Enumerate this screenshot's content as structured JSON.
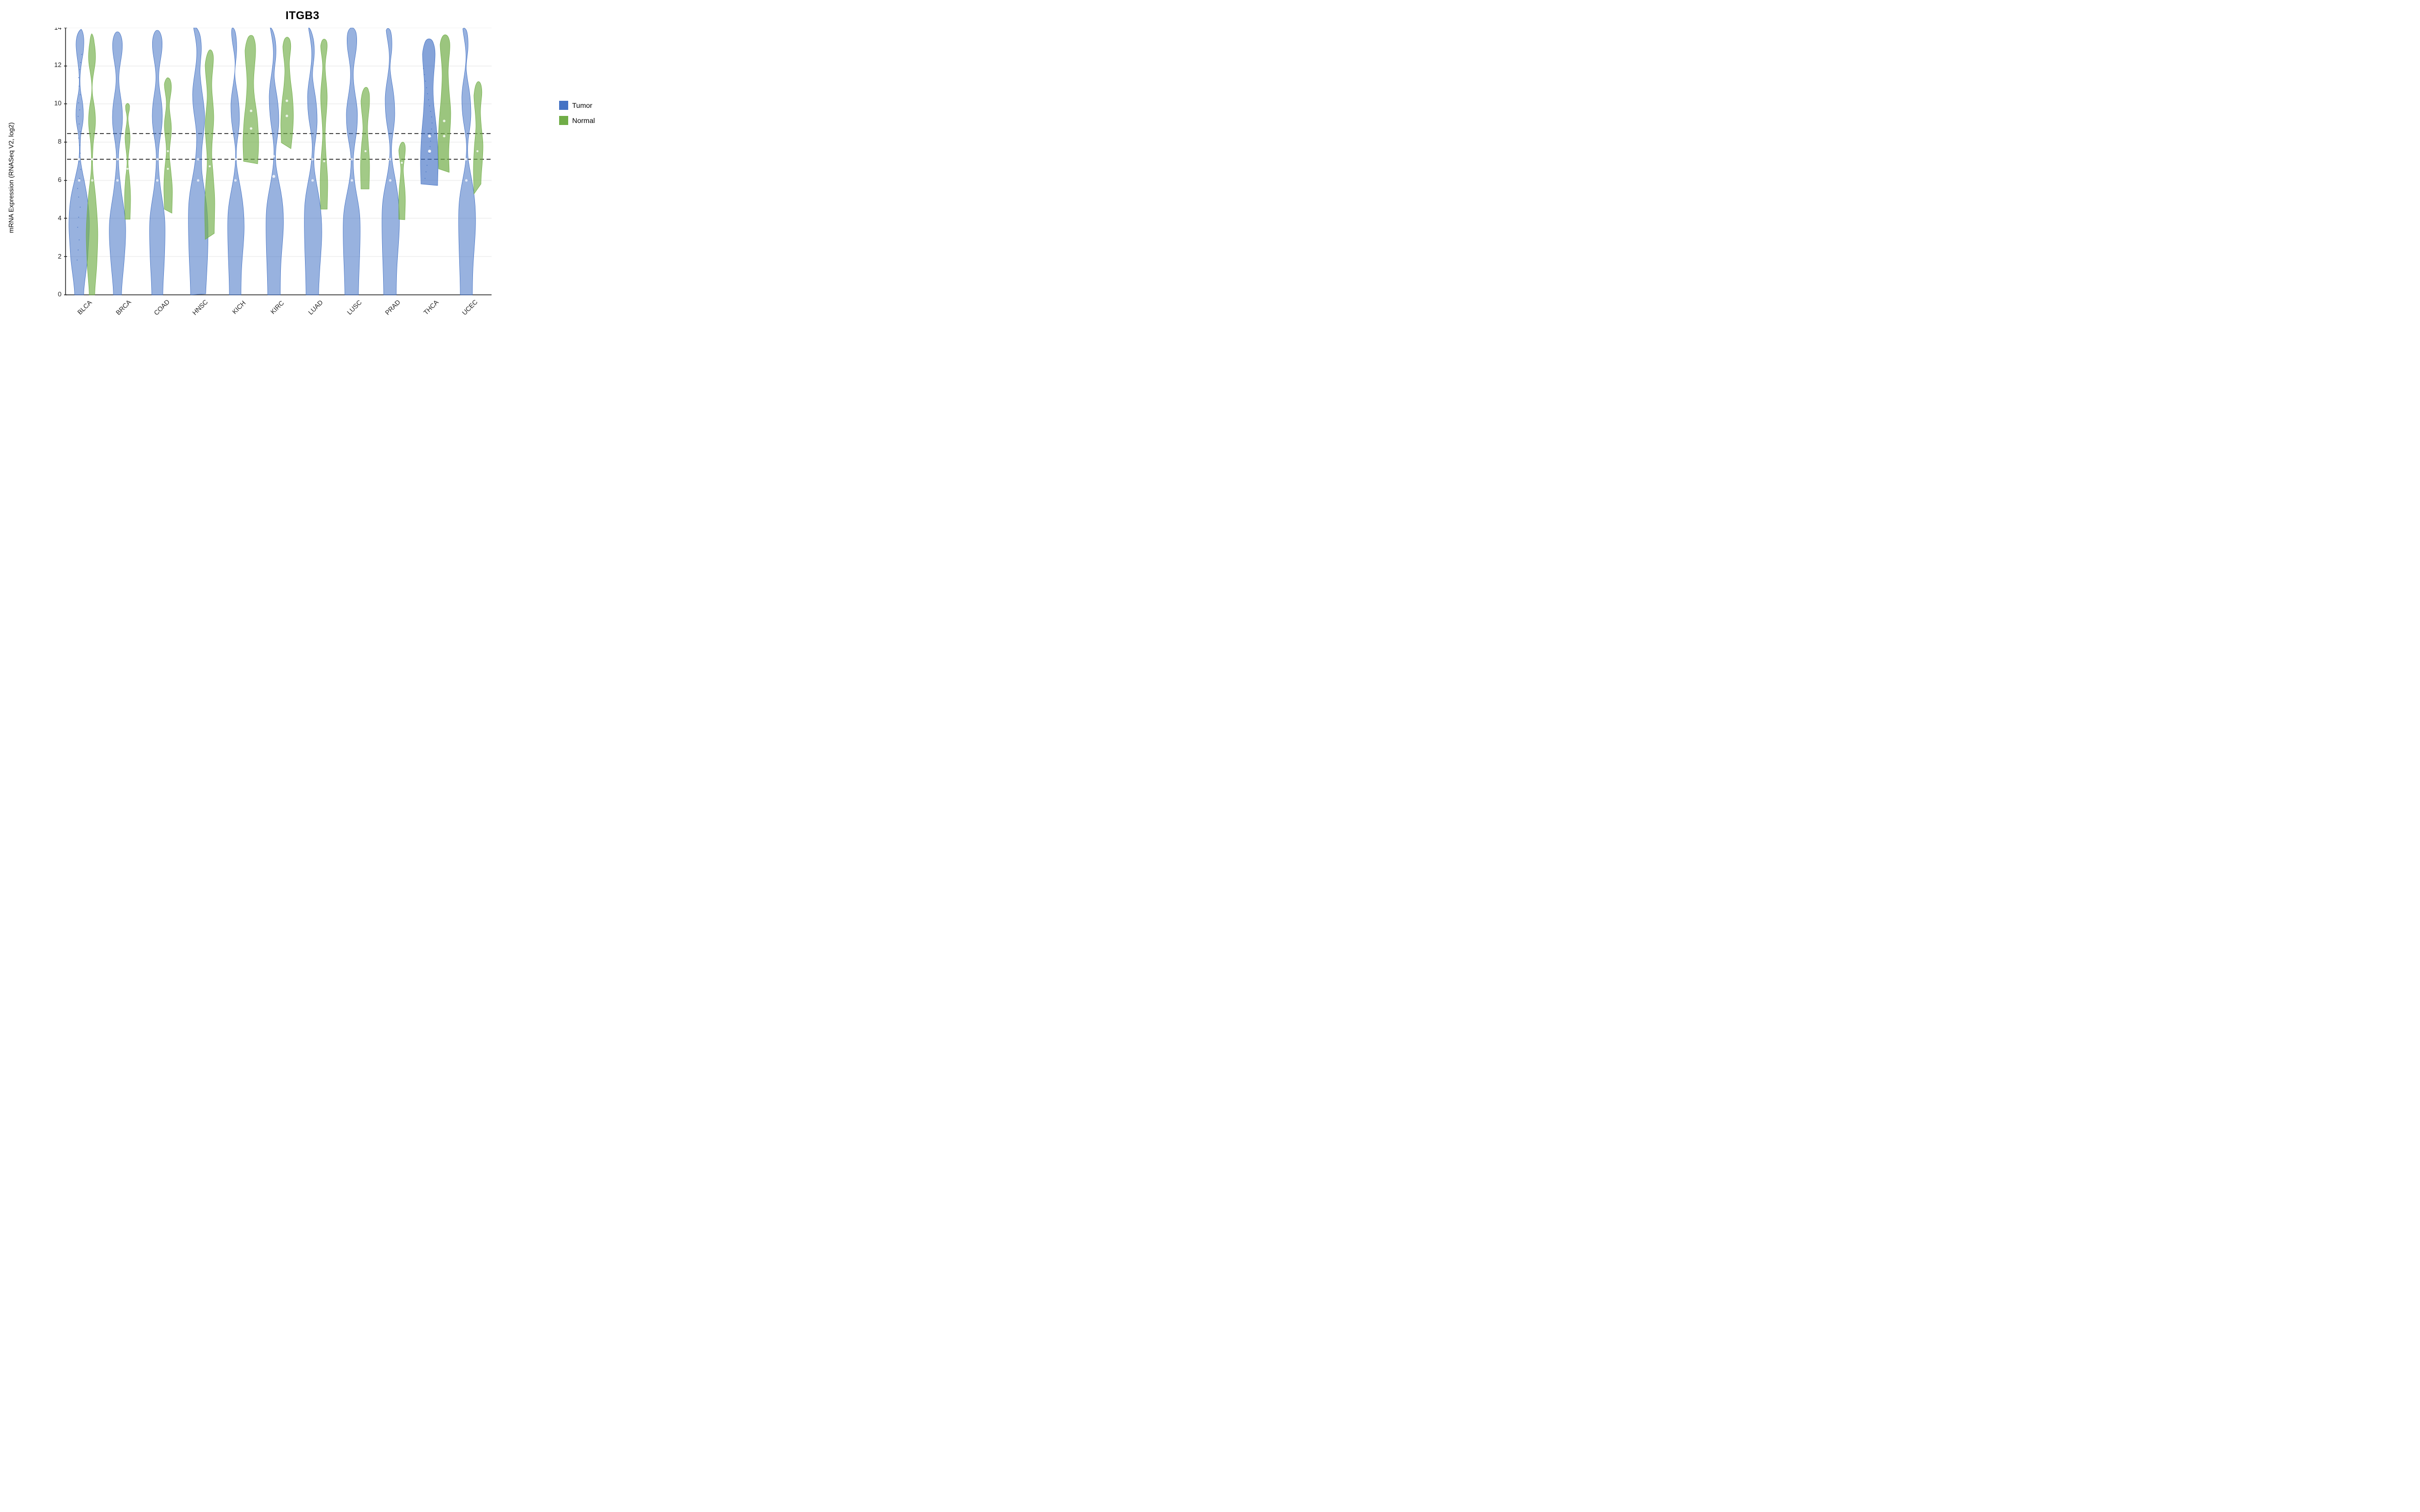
{
  "title": "ITGB3",
  "yAxis": {
    "label": "mRNA Expression (RNASeq V2, log2)",
    "ticks": [
      0,
      2,
      4,
      6,
      8,
      10,
      12,
      14
    ],
    "min": 0,
    "max": 14
  },
  "xAxis": {
    "categories": [
      "BLCA",
      "BRCA",
      "COAD",
      "HNSC",
      "KICH",
      "KIRC",
      "LUAD",
      "LUSC",
      "PRAD",
      "THCA",
      "UCEC"
    ]
  },
  "dashed_lines": [
    7.1,
    8.45
  ],
  "legend": {
    "items": [
      {
        "label": "Tumor",
        "color": "#4472C4"
      },
      {
        "label": "Normal",
        "color": "#70AD47"
      }
    ]
  },
  "colors": {
    "tumor": "#4472C4",
    "normal": "#70AD47",
    "tumor_fill": "rgba(68,114,196,0.5)",
    "normal_fill": "rgba(112,173,71,0.6)"
  }
}
